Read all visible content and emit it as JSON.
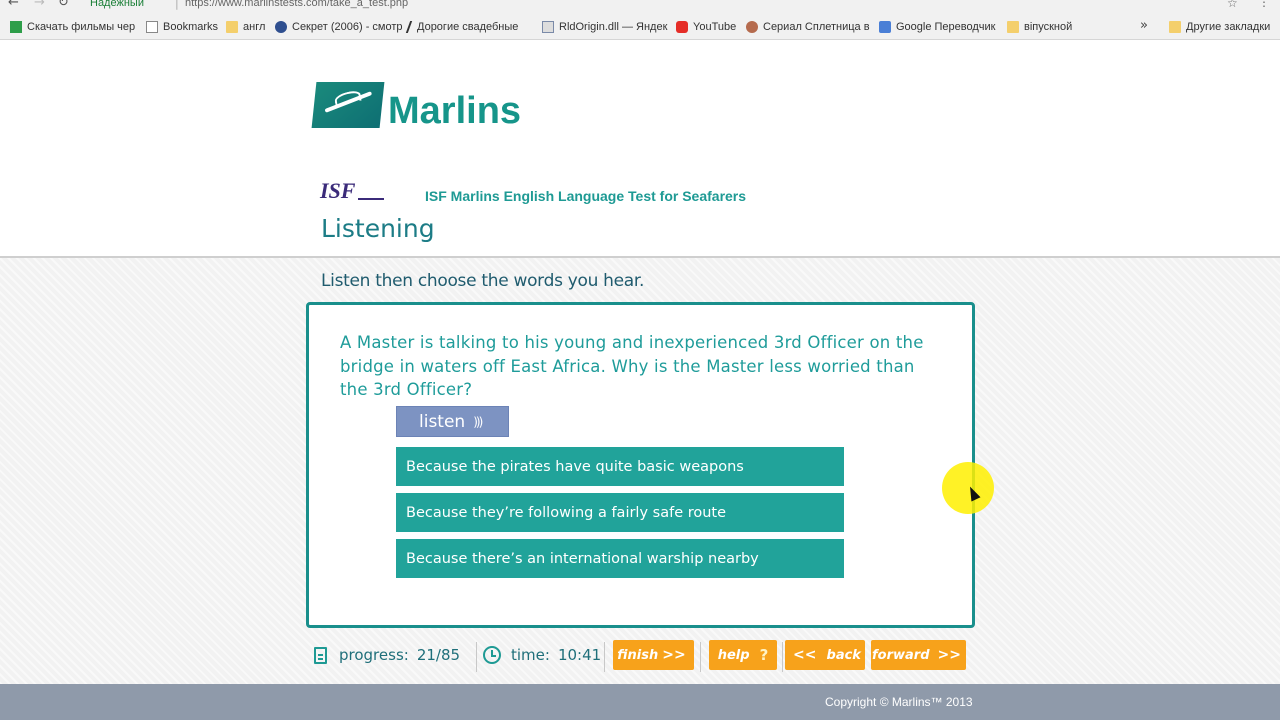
{
  "browser": {
    "security_label": "Надежный",
    "url": "https://www.marlinstests.com/take_a_test.php",
    "bookmarks": [
      {
        "label": "Скачать фильмы чер",
        "icon": "green-square-icon"
      },
      {
        "label": "Bookmarks",
        "icon": "page-icon"
      },
      {
        "label": "англ",
        "icon": "folder-icon"
      },
      {
        "label": "Секрет (2006) - смотр",
        "icon": "globe-icon"
      },
      {
        "label": "Дорогие свадебные",
        "icon": "slash-icon"
      },
      {
        "label": "RldOrigin.dll — Яндек",
        "icon": "doc-icon"
      },
      {
        "label": "YouTube",
        "icon": "youtube-icon"
      },
      {
        "label": "Сериал Сплетница в",
        "icon": "face-icon"
      },
      {
        "label": "Google Переводчик",
        "icon": "translate-icon"
      },
      {
        "label": "віпускной",
        "icon": "folder-icon"
      }
    ],
    "more_label": "»",
    "other_bookmarks": "Другие закладки"
  },
  "header": {
    "brand": "Marlins",
    "test_title": "ISF Marlins English Language Test for Seafarers",
    "section": "Listening"
  },
  "main": {
    "instruction": "Listen then choose the words you hear.",
    "question": "A Master is talking to his young and inexperienced 3rd Officer on the bridge in waters off East Africa. Why is the Master less worried than the 3rd Officer?",
    "listen_label": "listen",
    "answers": [
      "Because the pirates have quite basic weapons",
      "Because they’re following a fairly safe route",
      "Because there’s an international warship nearby"
    ]
  },
  "footer": {
    "progress_label": "progress:",
    "progress_value": "21/85",
    "time_label": "time:",
    "time_value": "10:41",
    "finish_label": "finish",
    "help_label": "help",
    "back_label": "back",
    "forward_label": "forward",
    "copyright": "Copyright © Marlins™ 2013"
  },
  "colors": {
    "teal": "#21a39a",
    "orange": "#f7a21b",
    "listen_button": "#7d93c2"
  }
}
